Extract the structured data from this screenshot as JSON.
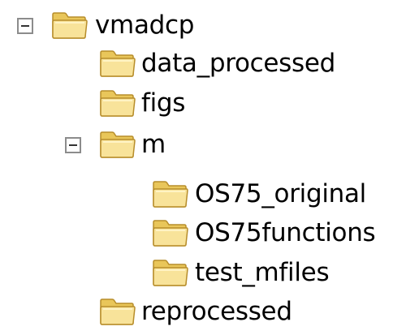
{
  "tree": {
    "root": {
      "label": "vmadcp",
      "expanded": true,
      "children": {
        "data_processed": {
          "label": "data_processed"
        },
        "figs": {
          "label": "figs"
        },
        "m": {
          "label": "m",
          "expanded": true,
          "children": {
            "os75_original": {
              "label": "OS75_original"
            },
            "os75functions": {
              "label": "OS75functions"
            },
            "test_mfiles": {
              "label": "test_mfiles"
            }
          }
        },
        "reprocessed": {
          "label": "reprocessed"
        }
      }
    }
  },
  "icons": {
    "folder": "folder-icon",
    "collapse": "minus-box-icon"
  },
  "colors": {
    "folder_body": "#f3d36b",
    "folder_front": "#f8e39a",
    "folder_outline": "#b78d2b",
    "toggle_border": "#8c8c8c"
  }
}
